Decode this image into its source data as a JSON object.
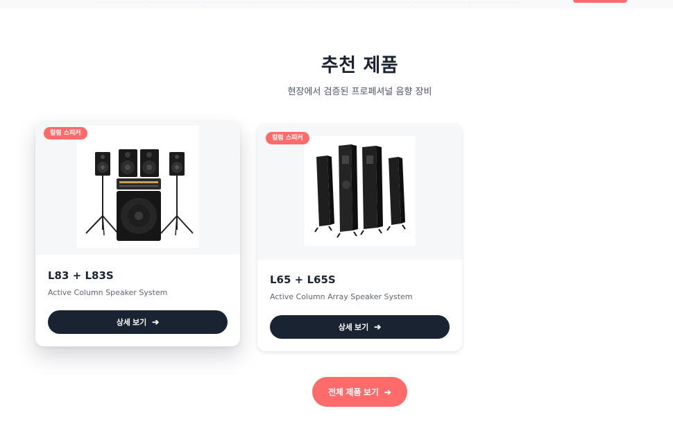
{
  "section": {
    "title": "추천 제품",
    "subtitle": "현장에서 검증된 프로페셔널 음향 장비"
  },
  "products": [
    {
      "badge": "컬럼 스피커",
      "name": "L83 + L83S",
      "description": "Active Column Speaker System",
      "button_label": "상세 보기",
      "button_icon": "arrow-right-icon"
    },
    {
      "badge": "컬럼 스피커",
      "name": "L65 + L65S",
      "description": "Active Column Array Speaker System",
      "button_label": "상세 보기",
      "button_icon": "arrow-right-icon"
    }
  ],
  "view_all": {
    "label": "전체 제품 보기",
    "icon": "arrow-right-icon"
  },
  "colors": {
    "accent": "#ff6b6b",
    "dark": "#1a2332",
    "card_media_bg": "#f6f7f9"
  }
}
